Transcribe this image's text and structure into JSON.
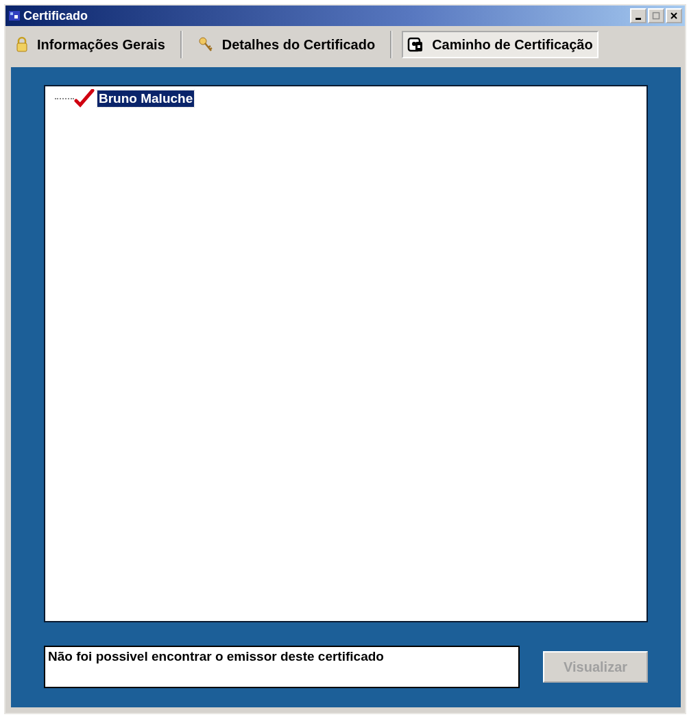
{
  "window": {
    "title": "Certificado"
  },
  "tabs": [
    {
      "label": "Informações Gerais",
      "selected": false,
      "kind": "lock"
    },
    {
      "label": "Detalhes do Certificado",
      "selected": false,
      "kind": "key"
    },
    {
      "label": "Caminho de Certificação",
      "selected": true,
      "kind": "path"
    }
  ],
  "tree": [
    {
      "label": "Bruno Maluche",
      "selected": true,
      "checked": true
    }
  ],
  "status": {
    "value": "Não foi possivel encontrar o emissor deste certificado"
  },
  "buttons": [
    {
      "label": "Visualizar",
      "disabled": true
    }
  ]
}
